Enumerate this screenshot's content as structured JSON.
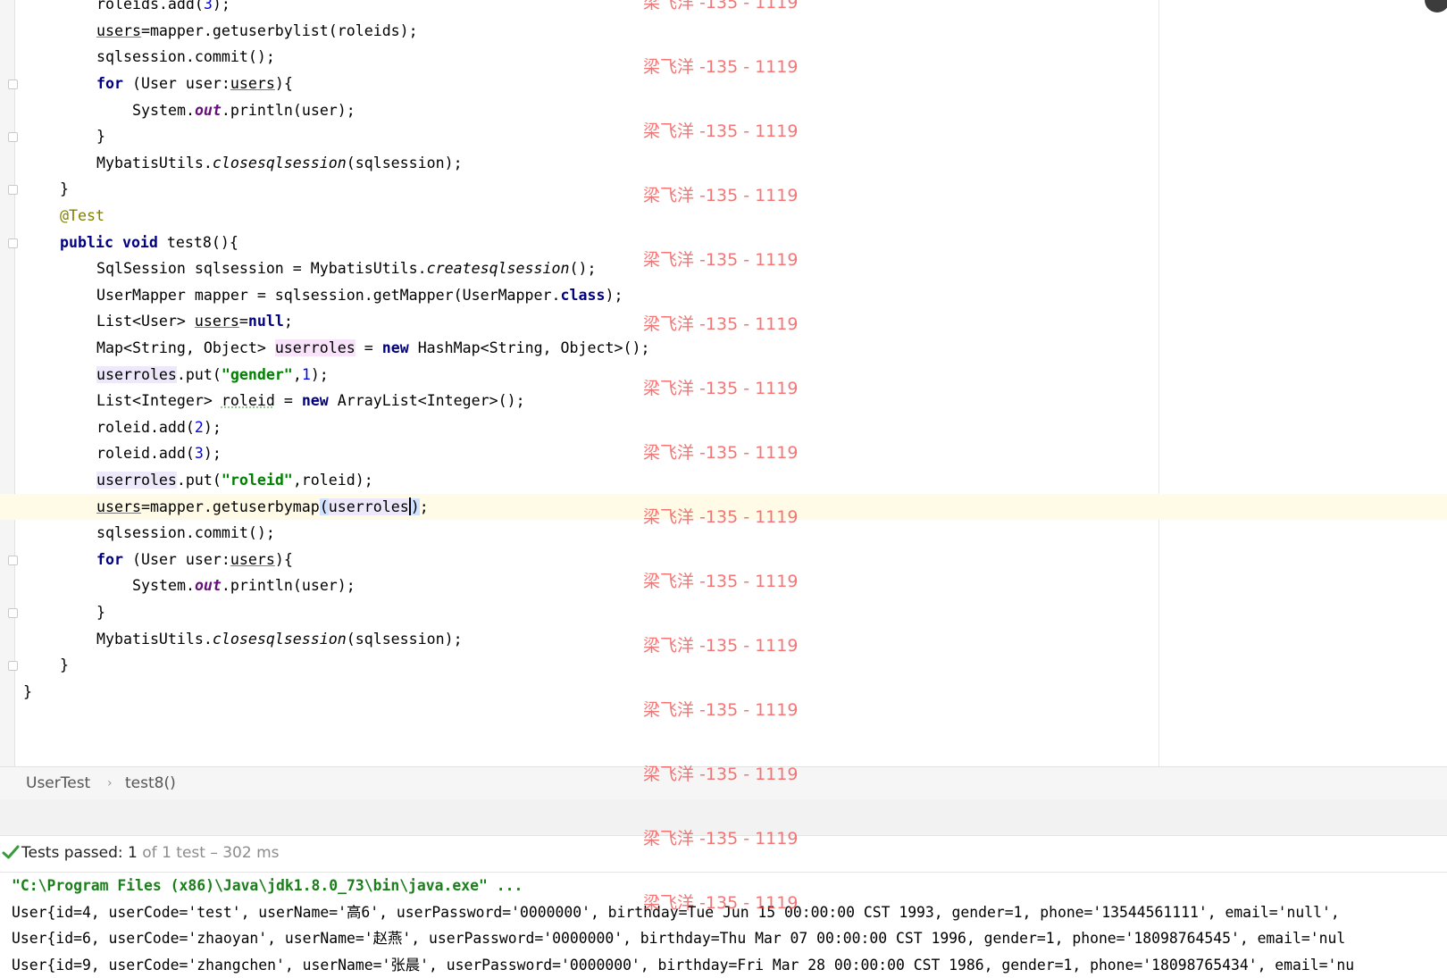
{
  "editor": {
    "lines": [
      {
        "indent": 2,
        "tokens": [
          [
            "t",
            "roleids.add("
          ],
          [
            "num",
            "3"
          ],
          [
            "t",
            ");"
          ]
        ]
      },
      {
        "indent": 2,
        "tokens": [
          [
            "ul",
            "users"
          ],
          [
            "t",
            "=mapper.getuserbylist(roleids);"
          ]
        ]
      },
      {
        "indent": 2,
        "tokens": [
          [
            "t",
            "sqlsession.commit();"
          ]
        ]
      },
      {
        "indent": 2,
        "tokens": [
          [
            "kw",
            "for"
          ],
          [
            "t",
            " (User user:"
          ],
          [
            "ul",
            "users"
          ],
          [
            "t",
            "){"
          ]
        ]
      },
      {
        "indent": 3,
        "tokens": [
          [
            "t",
            "System."
          ],
          [
            "field",
            "out"
          ],
          [
            "t",
            ".println(user);"
          ]
        ]
      },
      {
        "indent": 2,
        "tokens": [
          [
            "t",
            "}"
          ]
        ]
      },
      {
        "indent": 2,
        "tokens": [
          [
            "t",
            "MybatisUtils."
          ],
          [
            "static",
            "closesqlsession"
          ],
          [
            "t",
            "(sqlsession);"
          ]
        ]
      },
      {
        "indent": 1,
        "tokens": [
          [
            "t",
            "}"
          ]
        ]
      },
      {
        "indent": 1,
        "tokens": [
          [
            "anno",
            "@Test"
          ]
        ]
      },
      {
        "indent": 1,
        "tokens": [
          [
            "kw",
            "public"
          ],
          [
            "t",
            " "
          ],
          [
            "kw",
            "void"
          ],
          [
            "t",
            " test8(){"
          ]
        ]
      },
      {
        "indent": 2,
        "tokens": [
          [
            "t",
            "SqlSession sqlsession = MybatisUtils."
          ],
          [
            "static",
            "createsqlsession"
          ],
          [
            "t",
            "();"
          ]
        ]
      },
      {
        "indent": 2,
        "tokens": [
          [
            "t",
            "UserMapper mapper = sqlsession.getMapper(UserMapper."
          ],
          [
            "kw",
            "class"
          ],
          [
            "t",
            ");"
          ]
        ]
      },
      {
        "indent": 2,
        "tokens": [
          [
            "t",
            "List<User> "
          ],
          [
            "ul",
            "users"
          ],
          [
            "t",
            "="
          ],
          [
            "kw",
            "null"
          ],
          [
            "t",
            ";"
          ]
        ]
      },
      {
        "indent": 2,
        "tokens": [
          [
            "t",
            "Map<String, Object> "
          ],
          [
            "hlw",
            "userroles"
          ],
          [
            "t",
            " = "
          ],
          [
            "kw",
            "new"
          ],
          [
            "t",
            " HashMap<String, Object>();"
          ]
        ]
      },
      {
        "indent": 2,
        "tokens": [
          [
            "hlv",
            "userroles"
          ],
          [
            "t",
            ".put("
          ],
          [
            "str",
            "\"gender\""
          ],
          [
            "t",
            ","
          ],
          [
            "num",
            "1"
          ],
          [
            "t",
            ");"
          ]
        ]
      },
      {
        "indent": 2,
        "tokens": [
          [
            "t",
            "List<Integer> "
          ],
          [
            "wavy",
            "roleid"
          ],
          [
            "t",
            " = "
          ],
          [
            "kw",
            "new"
          ],
          [
            "t",
            " ArrayList<Integer>();"
          ]
        ]
      },
      {
        "indent": 2,
        "tokens": [
          [
            "t",
            "roleid.add("
          ],
          [
            "num",
            "2"
          ],
          [
            "t",
            ");"
          ]
        ]
      },
      {
        "indent": 2,
        "tokens": [
          [
            "t",
            "roleid.add("
          ],
          [
            "num",
            "3"
          ],
          [
            "t",
            ");"
          ]
        ]
      },
      {
        "indent": 2,
        "tokens": [
          [
            "hlv",
            "userroles"
          ],
          [
            "t",
            ".put("
          ],
          [
            "str",
            "\"roleid\""
          ],
          [
            "t",
            ",roleid);"
          ]
        ]
      },
      {
        "indent": 2,
        "current": true,
        "tokens": [
          [
            "ul",
            "users"
          ],
          [
            "t",
            "=mapper.getuserbymap"
          ],
          [
            "hlb",
            "("
          ],
          [
            "hlv",
            "userroles"
          ],
          [
            "caret",
            ""
          ],
          [
            "hlb",
            ")"
          ],
          [
            "t",
            ";"
          ]
        ]
      },
      {
        "indent": 2,
        "tokens": [
          [
            "t",
            "sqlsession.commit();"
          ]
        ]
      },
      {
        "indent": 2,
        "tokens": [
          [
            "kw",
            "for"
          ],
          [
            "t",
            " (User user:"
          ],
          [
            "ul",
            "users"
          ],
          [
            "t",
            "){"
          ]
        ]
      },
      {
        "indent": 3,
        "tokens": [
          [
            "t",
            "System."
          ],
          [
            "field",
            "out"
          ],
          [
            "t",
            ".println(user);"
          ]
        ]
      },
      {
        "indent": 2,
        "tokens": [
          [
            "t",
            "}"
          ]
        ]
      },
      {
        "indent": 2,
        "tokens": [
          [
            "t",
            "MybatisUtils."
          ],
          [
            "static",
            "closesqlsession"
          ],
          [
            "t",
            "(sqlsession);"
          ]
        ]
      },
      {
        "indent": 1,
        "tokens": [
          [
            "t",
            "}"
          ]
        ]
      },
      {
        "indent": 0,
        "tokens": [
          [
            "t",
            "}"
          ]
        ]
      }
    ]
  },
  "breadcrumb": {
    "class_name": "UserTest",
    "separator": "›",
    "method_name": "test8()"
  },
  "test_status": {
    "icon": "check-icon",
    "label": "Tests passed: ",
    "passed": "1",
    "rest": " of 1 test – 302 ms",
    "color": "#3a9a3a"
  },
  "console": {
    "lines": [
      {
        "type": "cmd",
        "text": "\"C:\\Program Files (x86)\\Java\\jdk1.8.0_73\\bin\\java.exe\" ..."
      },
      {
        "type": "out",
        "text": "User{id=4, userCode='test', userName='高6', userPassword='0000000', birthday=Tue Jun 15 00:00:00 CST 1993, gender=1, phone='13544561111', email='null', "
      },
      {
        "type": "out",
        "text": "User{id=6, userCode='zhaoyan', userName='赵燕', userPassword='0000000', birthday=Thu Mar 07 00:00:00 CST 1996, gender=1, phone='18098764545', email='nul"
      },
      {
        "type": "out",
        "text": "User{id=9, userCode='zhangchen', userName='张晨', userPassword='0000000', birthday=Fri Mar 28 00:00:00 CST 1986, gender=1, phone='18098765434', email='nu"
      }
    ]
  },
  "watermark": {
    "text": "梁飞洋 -135 - 1119",
    "count": 15,
    "color": "#f05050"
  }
}
